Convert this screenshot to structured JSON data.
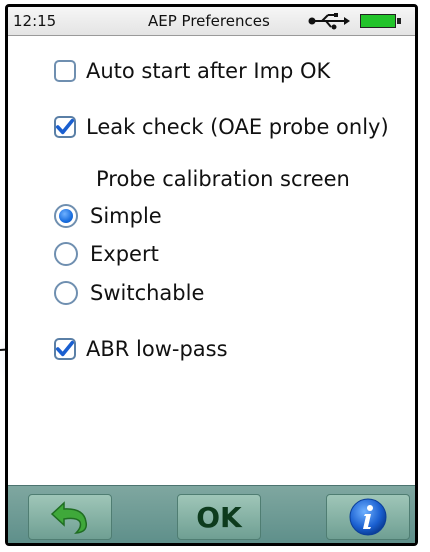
{
  "status_bar": {
    "time": "12:15",
    "title": "AEP Preferences",
    "usb_icon": "usb-icon",
    "battery_icon": "battery-icon",
    "battery_color": "#22c32a"
  },
  "options": {
    "auto_start": {
      "label": "Auto start after Imp OK",
      "checked": false
    },
    "leak_check": {
      "label": "Leak check (OAE probe only)",
      "checked": true
    },
    "probe_calibration_heading": "Probe calibration screen",
    "radio_simple": {
      "label": "Simple",
      "selected": true
    },
    "radio_expert": {
      "label": "Expert",
      "selected": false
    },
    "radio_switchable": {
      "label": "Switchable",
      "selected": false
    },
    "abr_lowpass": {
      "label": "ABR low-pass",
      "checked": true
    }
  },
  "bottom_bar": {
    "back_icon": "back-arrow-icon",
    "ok_label": "OK",
    "info_icon": "info-icon"
  },
  "colors": {
    "checkbox_border": "#6f8fb0",
    "check_mark": "#1a5fd0",
    "radio_fill": "#1a6fe0",
    "bottom_bar": "#6f9f93"
  }
}
